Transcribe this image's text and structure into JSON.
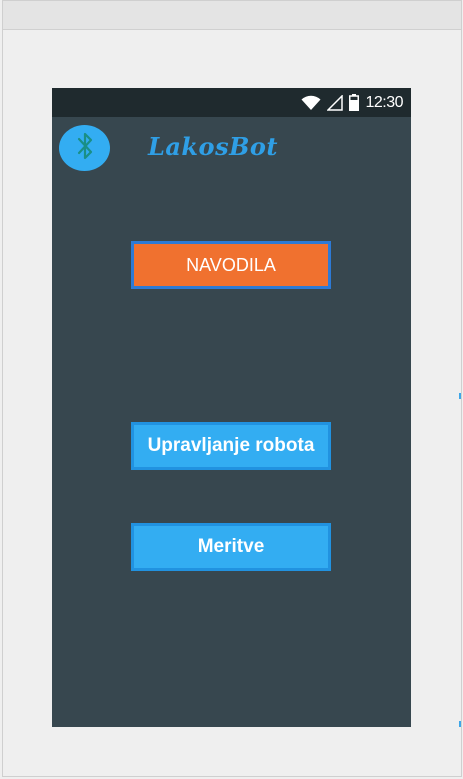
{
  "statusbar": {
    "time": "12:30",
    "icons": [
      "wifi-icon",
      "signal-icon",
      "battery-icon"
    ]
  },
  "header": {
    "bluetooth_icon": "bluetooth-icon",
    "title": "LakosBot"
  },
  "buttons": {
    "navodila": "NAVODILA",
    "upravljanje": "Upravljanje robota",
    "meritve": "Meritve"
  },
  "colors": {
    "background": "#37474f",
    "statusbar": "#1f2a2e",
    "accent_blue": "#33adf2",
    "orange": "#f0712f"
  }
}
